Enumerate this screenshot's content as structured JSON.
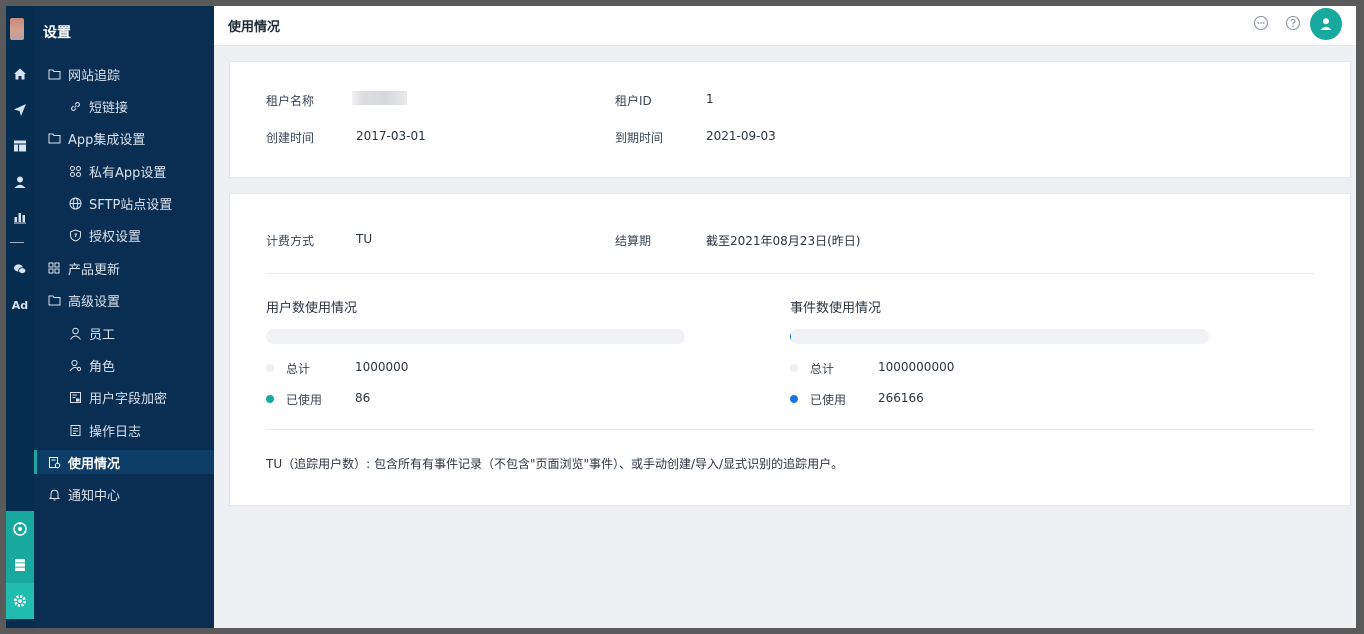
{
  "menu": {
    "title": "设置",
    "items": [
      {
        "label": "网站追踪",
        "icon": "folder-icon",
        "level": 1
      },
      {
        "label": "短链接",
        "icon": "link-icon",
        "level": 2
      },
      {
        "label": "App集成设置",
        "icon": "folder-icon",
        "level": 1
      },
      {
        "label": "私有App设置",
        "icon": "command-icon",
        "level": 2
      },
      {
        "label": "SFTP站点设置",
        "icon": "globe-icon",
        "level": 2
      },
      {
        "label": "授权设置",
        "icon": "shield-icon",
        "level": 2
      },
      {
        "label": "产品更新",
        "icon": "grid-icon",
        "level": 1
      },
      {
        "label": "高级设置",
        "icon": "folder-icon",
        "level": 1
      },
      {
        "label": "员工",
        "icon": "user-icon",
        "level": 2
      },
      {
        "label": "角色",
        "icon": "user-role-icon",
        "level": 2
      },
      {
        "label": "用户字段加密",
        "icon": "encrypt-icon",
        "level": 2
      },
      {
        "label": "操作日志",
        "icon": "log-icon",
        "level": 2
      },
      {
        "label": "使用情况",
        "icon": "usage-icon",
        "level": 1,
        "active": true
      },
      {
        "label": "通知中心",
        "icon": "bell-icon",
        "level": 1
      }
    ]
  },
  "rail": {
    "ad_label": "Ad",
    "icons": [
      "home-icon",
      "send-icon",
      "layout-icon",
      "person-icon",
      "bar-chart-icon",
      "wechat-icon"
    ]
  },
  "header": {
    "title": "使用情况",
    "icons": [
      "chat-icon",
      "help-icon",
      "avatar-icon"
    ]
  },
  "tenant": {
    "name_label": "租户名称",
    "name_value": "",
    "id_label": "租户ID",
    "id_value": "1",
    "created_label": "创建时间",
    "created_value": "2017-03-01",
    "expire_label": "到期时间",
    "expire_value": "2021-09-03"
  },
  "billing": {
    "method_label": "计费方式",
    "method_value": "TU",
    "period_label": "结算期",
    "period_value": "截至2021年08月23日(昨日)"
  },
  "usage": {
    "users": {
      "title": "用户数使用情况",
      "total_label": "总计",
      "total_value": "1000000",
      "used_label": "已使用",
      "used_value": "86",
      "used_fraction": 8.6e-05,
      "color": "#17a99e"
    },
    "events": {
      "title": "事件数使用情况",
      "total_label": "总计",
      "total_value": "1000000000",
      "used_label": "已使用",
      "used_value": "266166",
      "used_fraction": 0.000266,
      "color": "#1677e0"
    }
  },
  "note": "TU（追踪用户数）: 包含所有有事件记录（不包含\"页面浏览\"事件）、或手动创建/导入/显式识别的追踪用户。",
  "colors": {
    "sidebar": "#0a2d52",
    "rail": "#062c4f",
    "accent": "#17a99e",
    "events_accent": "#1677e0"
  }
}
